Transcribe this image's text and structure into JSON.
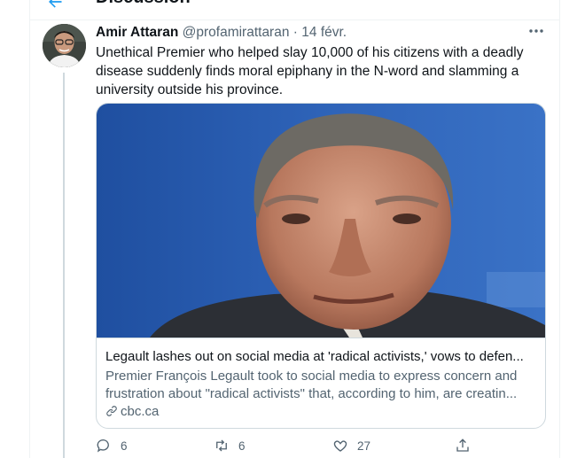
{
  "header": {
    "title": "Discussion"
  },
  "tweet": {
    "author_name": "Amir Attaran",
    "author_handle": "@profamirattaran",
    "separator": "·",
    "date": "14 févr.",
    "text": "Unethical Premier who helped slay 10,000 of his citizens with a deadly disease suddenly finds moral epiphany in the N-word and slamming a university outside his province."
  },
  "card": {
    "title": "Legault lashes out on social media at 'radical activists,' vows to defen...",
    "description": "Premier François Legault took to social media to express concern and frustration about \"radical activists\" that, according to him, are creatin...",
    "domain": "cbc.ca"
  },
  "actions": {
    "replies": "6",
    "retweets": "6",
    "likes": "27"
  },
  "icons": [
    "back-arrow-icon",
    "more-icon",
    "link-icon",
    "reply-icon",
    "retweet-icon",
    "like-icon",
    "share-icon"
  ],
  "colors": {
    "accent": "#1d9bf0",
    "secondary_text": "#536471",
    "border": "#cfd9de"
  }
}
